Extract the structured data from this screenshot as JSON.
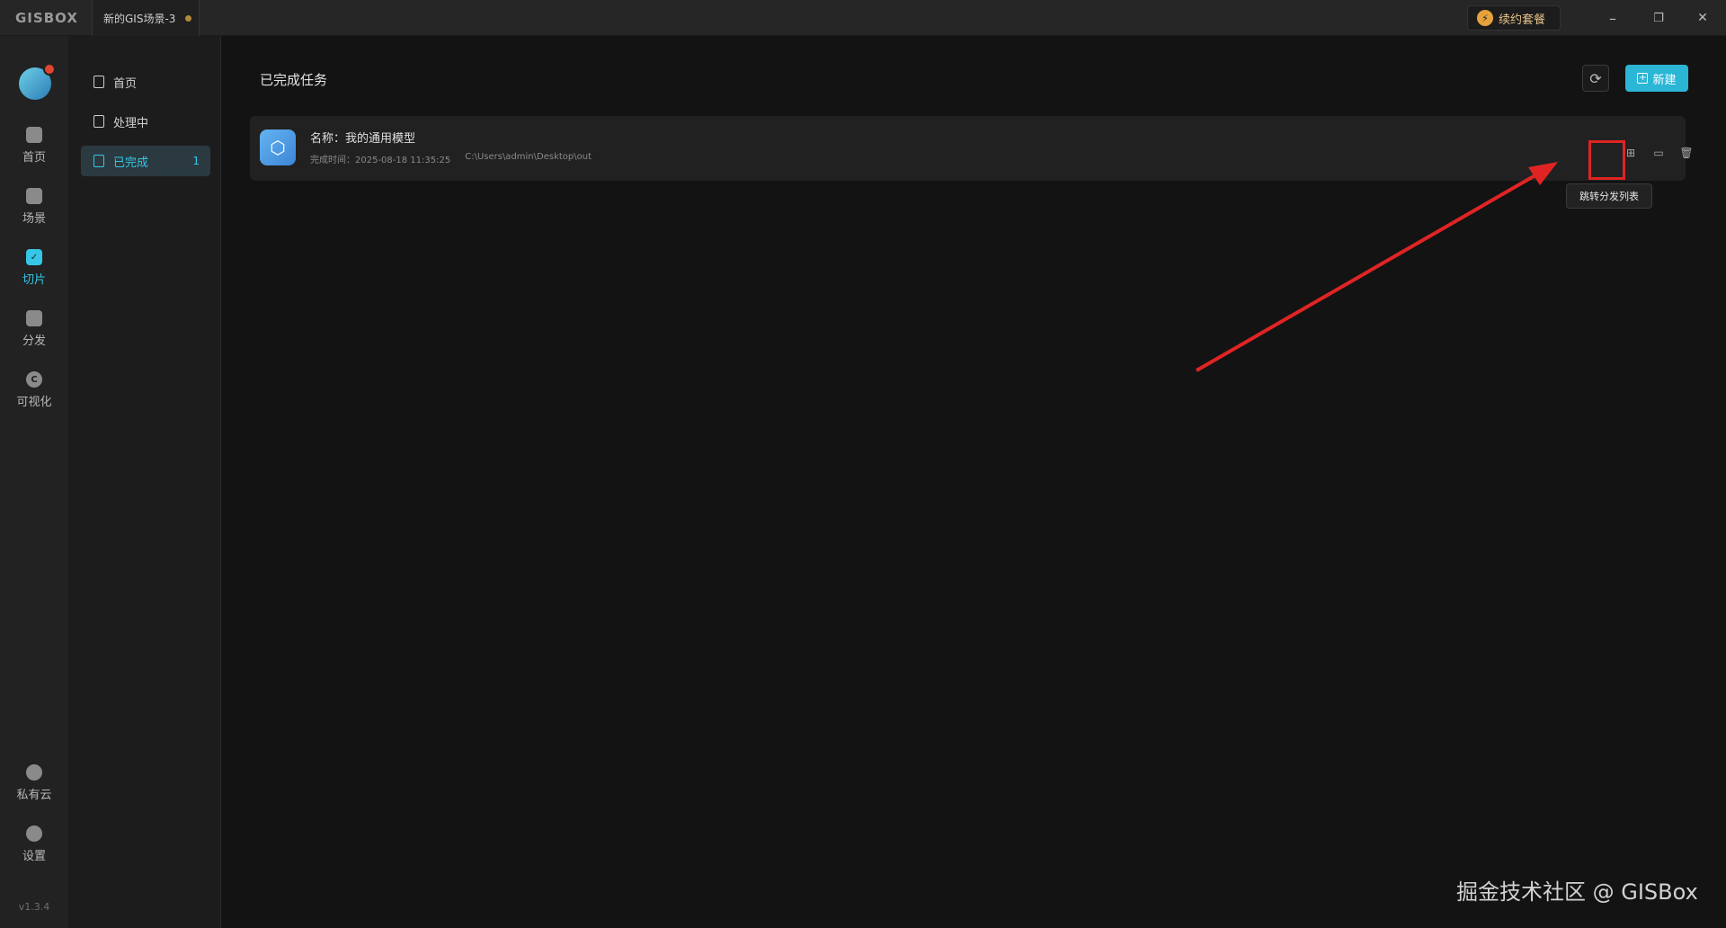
{
  "titlebar": {
    "logo": "GISBOX",
    "tab_title": "新的GIS场景-3",
    "package_label": "续约套餐",
    "minimize": "–",
    "restore": "❐",
    "close": "✕"
  },
  "leftnav": {
    "items": [
      {
        "label": "首页"
      },
      {
        "label": "场景"
      },
      {
        "label": "切片"
      },
      {
        "label": "分发"
      },
      {
        "label": "可视化"
      },
      {
        "label": "私有云"
      },
      {
        "label": "设置"
      }
    ],
    "active": "切片",
    "version": "v1.3.4"
  },
  "subnav": {
    "items": [
      {
        "label": "首页"
      },
      {
        "label": "处理中"
      },
      {
        "label": "已完成",
        "count": "1"
      }
    ],
    "active": "已完成"
  },
  "main": {
    "title": "已完成任务",
    "new_label": "新建",
    "task": {
      "name": "名称：我的通用模型",
      "time": "完成时间：2025-08-18 11:35:25",
      "path": "C:\\Users\\admin\\Desktop\\out"
    },
    "tooltip": "跳转分发列表"
  },
  "colors": {
    "accent": "#36c6e6",
    "highlight": "#e02424"
  },
  "watermark": "掘金技术社区 @ GISBox"
}
